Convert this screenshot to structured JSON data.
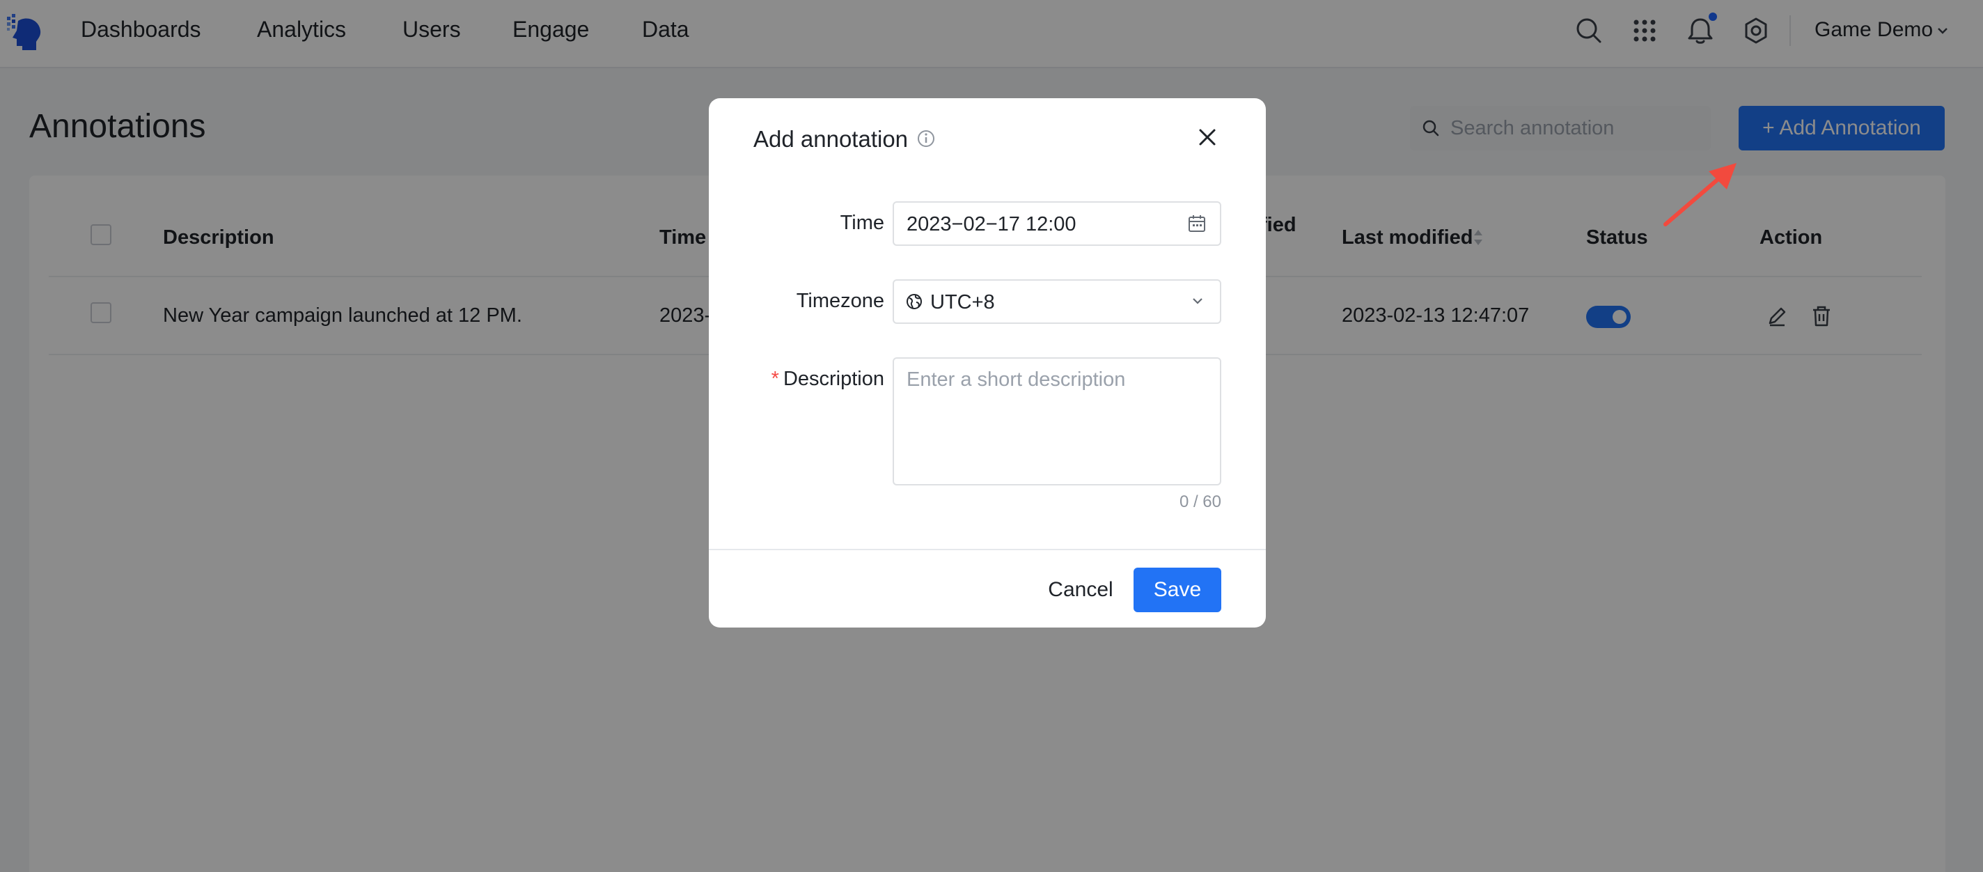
{
  "topbar": {
    "nav": [
      "Dashboards",
      "Analytics",
      "Users",
      "Engage",
      "Data"
    ],
    "project": "Game Demo"
  },
  "page": {
    "title": "Annotations",
    "search_placeholder": "Search annotation",
    "add_button": "+ Add Annotation"
  },
  "table": {
    "headers": {
      "description": "Description",
      "time": "Time",
      "modified_partial": "fied",
      "last_modified": "Last modified",
      "status": "Status",
      "action": "Action"
    },
    "rows": [
      {
        "description": "New Year campaign launched at 12 PM.",
        "time_partial": "2023-",
        "last_modified": "2023-02-13 12:47:07",
        "status_enabled": true
      }
    ]
  },
  "modal": {
    "title": "Add annotation",
    "time_label": "Time",
    "time_value": "2023−02−17 12:00",
    "timezone_label": "Timezone",
    "timezone_value": "UTC+8",
    "description_label": "Description",
    "required_marker": "*",
    "description_placeholder": "Enter a short description",
    "counter": "0 / 60",
    "cancel": "Cancel",
    "save": "Save"
  },
  "colors": {
    "primary": "#2273f5",
    "required": "#f54a45",
    "annotation_arrow": "#f24a3e",
    "notification_dot": "#1f66ff"
  }
}
